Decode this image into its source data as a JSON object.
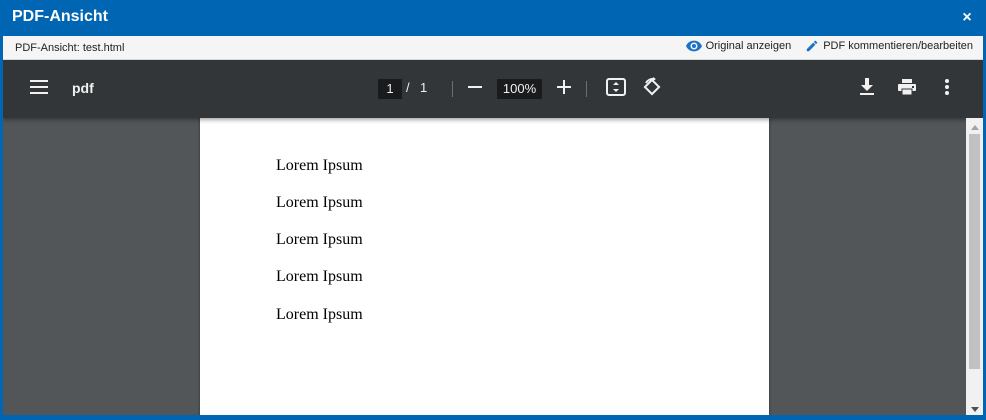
{
  "dialog": {
    "title": "PDF-Ansicht",
    "close_symbol": "×"
  },
  "infobar": {
    "filename": "PDF-Ansicht: test.html",
    "show_original": "Original anzeigen",
    "edit_pdf": "PDF kommentieren/bearbeiten",
    "show_original_icon": "eye-icon",
    "edit_pdf_icon": "pencil-icon",
    "accent_color": "#1a73c8"
  },
  "toolbar": {
    "menu_icon": "hamburger-menu-icon",
    "title": "pdf",
    "current_page": "1",
    "page_separator": "/",
    "total_pages": "1",
    "zoom_out_icon": "minus-icon",
    "zoom_level": "100%",
    "zoom_in_icon": "plus-icon",
    "fit_icon": "fit-to-page-icon",
    "rotate_icon": "rotate-icon",
    "download_icon": "download-icon",
    "print_icon": "print-icon",
    "more_icon": "more-vertical-icon",
    "background": "#323639"
  },
  "document": {
    "lines": [
      "Lorem Ipsum",
      "Lorem Ipsum",
      "Lorem Ipsum",
      "Lorem Ipsum",
      "Lorem Ipsum"
    ],
    "viewer_background": "#525659"
  }
}
